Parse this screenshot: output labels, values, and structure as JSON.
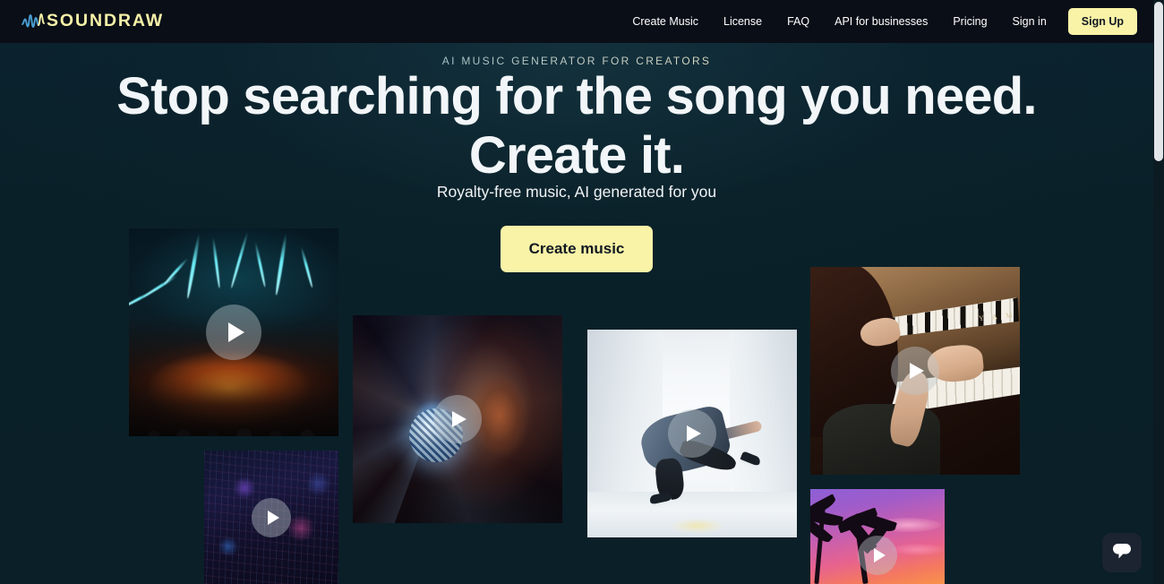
{
  "header": {
    "logo": {
      "icon": "soundwave-icon",
      "text": "SOUNDRAW"
    },
    "nav": [
      {
        "label": "Create Music",
        "name": "nav-create-music"
      },
      {
        "label": "License",
        "name": "nav-license"
      },
      {
        "label": "FAQ",
        "name": "nav-faq"
      },
      {
        "label": "API for businesses",
        "name": "nav-api-for-businesses"
      },
      {
        "label": "Pricing",
        "name": "nav-pricing"
      },
      {
        "label": "Sign in",
        "name": "nav-sign-in"
      }
    ],
    "signup_label": "Sign Up"
  },
  "hero": {
    "eyebrow": "AI MUSIC GENERATOR FOR CREATORS",
    "headline_line1": "Stop searching for the song you need.",
    "headline_line2": "Create it.",
    "subtitle": "Royalty-free music, AI generated for you",
    "cta_label": "Create music"
  },
  "cards": [
    {
      "name": "video-card-concert",
      "alt": "Concert with cyan lasers and orange stage lights",
      "play_icon": "play-icon"
    },
    {
      "name": "video-card-city",
      "alt": "Neon city skyline at night",
      "play_icon": "play-icon"
    },
    {
      "name": "video-card-disco",
      "alt": "Woman holding a glowing disco ball",
      "play_icon": "play-icon"
    },
    {
      "name": "video-card-dancer",
      "alt": "Breakdancer in a white room",
      "play_icon": "play-icon"
    },
    {
      "name": "video-card-piano",
      "alt": "Hands playing a Yamaha upright piano",
      "play_icon": "play-icon"
    },
    {
      "name": "video-card-palm",
      "alt": "Palm trees against a purple sunset",
      "play_icon": "play-icon"
    }
  ],
  "chat": {
    "icon": "chat-bubble-icon"
  },
  "colors": {
    "accent_yellow": "#f9f3a8",
    "header_bg": "#0a0e17",
    "page_bg": "#0a2028",
    "logo_wave": "#4a9fd4"
  }
}
